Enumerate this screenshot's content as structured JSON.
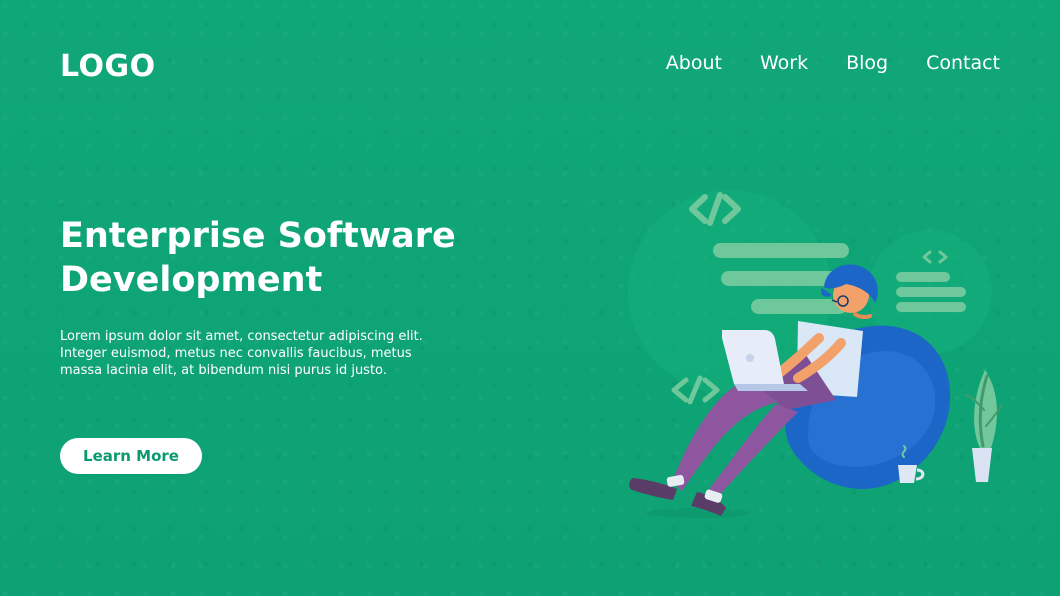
{
  "brand": {
    "logo": "LOGO"
  },
  "nav": {
    "items": [
      {
        "label": "About"
      },
      {
        "label": "Work"
      },
      {
        "label": "Blog"
      },
      {
        "label": "Contact"
      }
    ]
  },
  "hero": {
    "title": "Enterprise Software Development",
    "text": "Lorem ipsum dolor sit amet, consectetur adipiscing elit. Integer euismod, metus nec convallis faucibus, metus massa lacinia elit, at bibendum nisi purus id justo.",
    "cta_label": "Learn More"
  },
  "illustration": {
    "icons": [
      "code-icon",
      "laptop-icon",
      "plant-icon",
      "coffee-cup-icon"
    ]
  },
  "colors": {
    "background": "#0fa676",
    "button_text": "#0b9a6f",
    "white": "#ffffff"
  }
}
